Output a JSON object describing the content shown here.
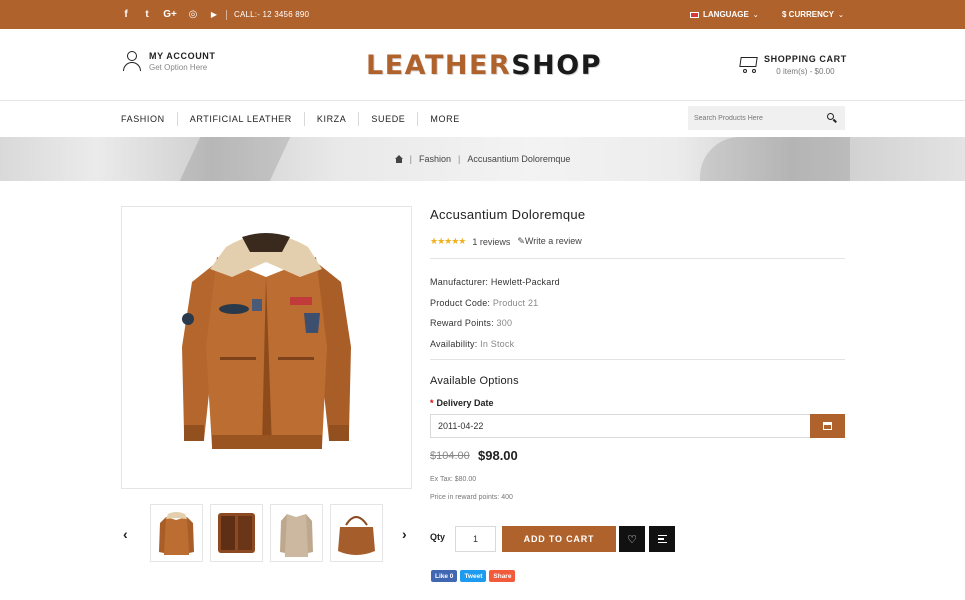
{
  "topbar": {
    "social": [
      {
        "name": "facebook-icon",
        "glyph": "f"
      },
      {
        "name": "twitter-icon",
        "glyph": "t"
      },
      {
        "name": "google-plus-icon",
        "glyph": "G+"
      },
      {
        "name": "instagram-icon",
        "glyph": "◎"
      },
      {
        "name": "youtube-icon",
        "glyph": "▶"
      }
    ],
    "call": "CALL:- 12 3456 890",
    "language": "LANGUAGE",
    "currency": "$ CURRENCY"
  },
  "header": {
    "account_title": "MY ACCOUNT",
    "account_sub": "Get Option Here",
    "logo_part1": "LEATHER",
    "logo_part2": "SHOP",
    "cart_title": "SHOPPING CART",
    "cart_sub": "0 item(s) - $0.00"
  },
  "nav": {
    "items": [
      "FASHION",
      "ARTIFICIAL LEATHER",
      "KIRZA",
      "SUEDE",
      "MORE"
    ],
    "search_placeholder": "Search Products Here"
  },
  "breadcrumb": {
    "items": [
      "Fashion",
      "Accusantium Doloremque"
    ]
  },
  "product": {
    "title": "Accusantium Doloremque",
    "rating_stars": 5,
    "reviews": "1 reviews",
    "write_review": "Write a review",
    "specs": [
      {
        "label": "Manufacturer:",
        "value": "Hewlett-Packard"
      },
      {
        "label": "Product Code:",
        "value": "Product 21"
      },
      {
        "label": "Reward Points:",
        "value": "300"
      },
      {
        "label": "Availability:",
        "value": "In Stock"
      }
    ],
    "options_heading": "Available Options",
    "delivery_label": "Delivery Date",
    "delivery_value": "2011-04-22",
    "old_price": "$104.00",
    "price": "$98.00",
    "ex_tax": "Ex Tax: $80.00",
    "reward_price": "Price in reward points: 400",
    "qty_label": "Qty",
    "qty_value": "1",
    "add_to_cart": "ADD TO CART",
    "share": {
      "like": "Like 0",
      "tweet": "Tweet",
      "share": "Share"
    }
  },
  "colors": {
    "accent": "#b0622d",
    "leather": "#b4662c",
    "dark": "#111111",
    "star": "#f2b01e"
  }
}
